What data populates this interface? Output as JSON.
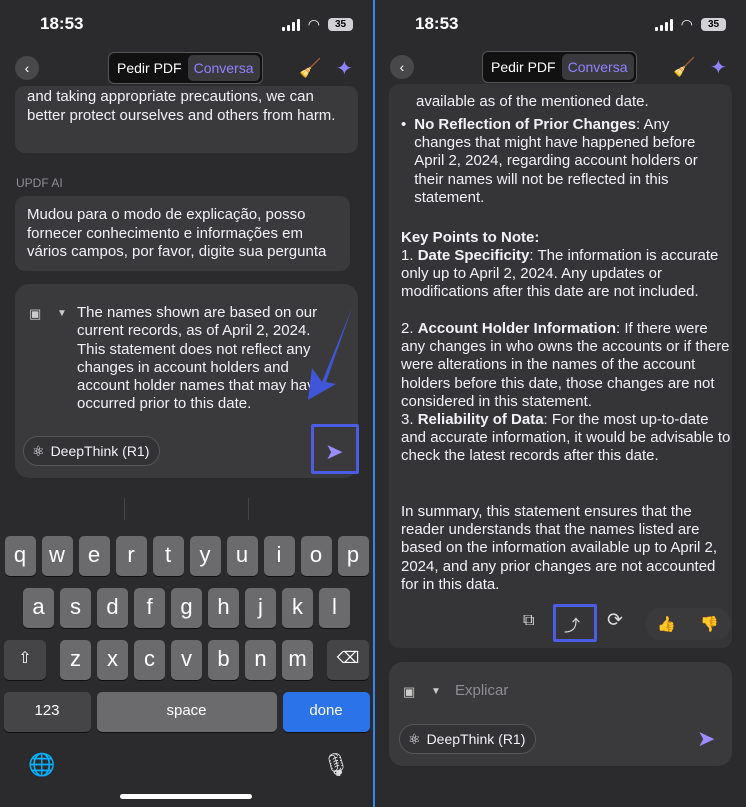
{
  "status": {
    "time": "18:53",
    "battery": "35"
  },
  "header": {
    "tab_pdf": "Pedir PDF",
    "tab_chat": "Conversa"
  },
  "left": {
    "msg_prev": "and taking appropriate precautions, we can better protect ourselves and others from harm.",
    "ai_label": "UPDF AI",
    "ai_msg": "Mudou para o modo de explicação, posso fornecer conhecimento e informações em vários campos, por favor, digite sua pergunta",
    "input_text": "The names shown are based on our current records, as of April 2, 2024. This statement does not reflect any changes in account holders and account holder names that may have occurred prior to this date.",
    "deepthink": "DeepThink (R1)"
  },
  "keyboard": {
    "row1": [
      "q",
      "w",
      "e",
      "r",
      "t",
      "y",
      "u",
      "i",
      "o",
      "p"
    ],
    "row2": [
      "a",
      "s",
      "d",
      "f",
      "g",
      "h",
      "j",
      "k",
      "l"
    ],
    "row3": [
      "z",
      "x",
      "c",
      "v",
      "b",
      "n",
      "m"
    ],
    "numbers": "123",
    "space": "space",
    "done": "done"
  },
  "right": {
    "top_line": "available as of the mentioned date.",
    "bullet_title": "No Reflection of Prior Changes",
    "bullet_body": ": Any changes that might have happened before April 2, 2024, regarding account holders or their names will not be reflected in this statement.",
    "key_points": "Key Points to Note:",
    "p1_title": "Date Specificity",
    "p1_body": ": The information is accurate only up to April 2, 2024. Any updates or modifications after this date are not included.",
    "p2_title": "Account Holder Information",
    "p2_body": ": If there were any changes in who owns the accounts or if there were alterations in the names of the account holders before this date, those changes are not considered in this statement.",
    "p3_title": "Reliability of Data",
    "p3_body": ": For the most up-to-date and accurate information, it would be advisable to check the latest records after this date.",
    "summary": "In summary, this statement ensures that the reader understands that the names listed are based on the information available up to April 2, 2024, and any prior changes are not accounted for in this data.",
    "placeholder": "Explicar",
    "deepthink": "DeepThink (R1)"
  }
}
